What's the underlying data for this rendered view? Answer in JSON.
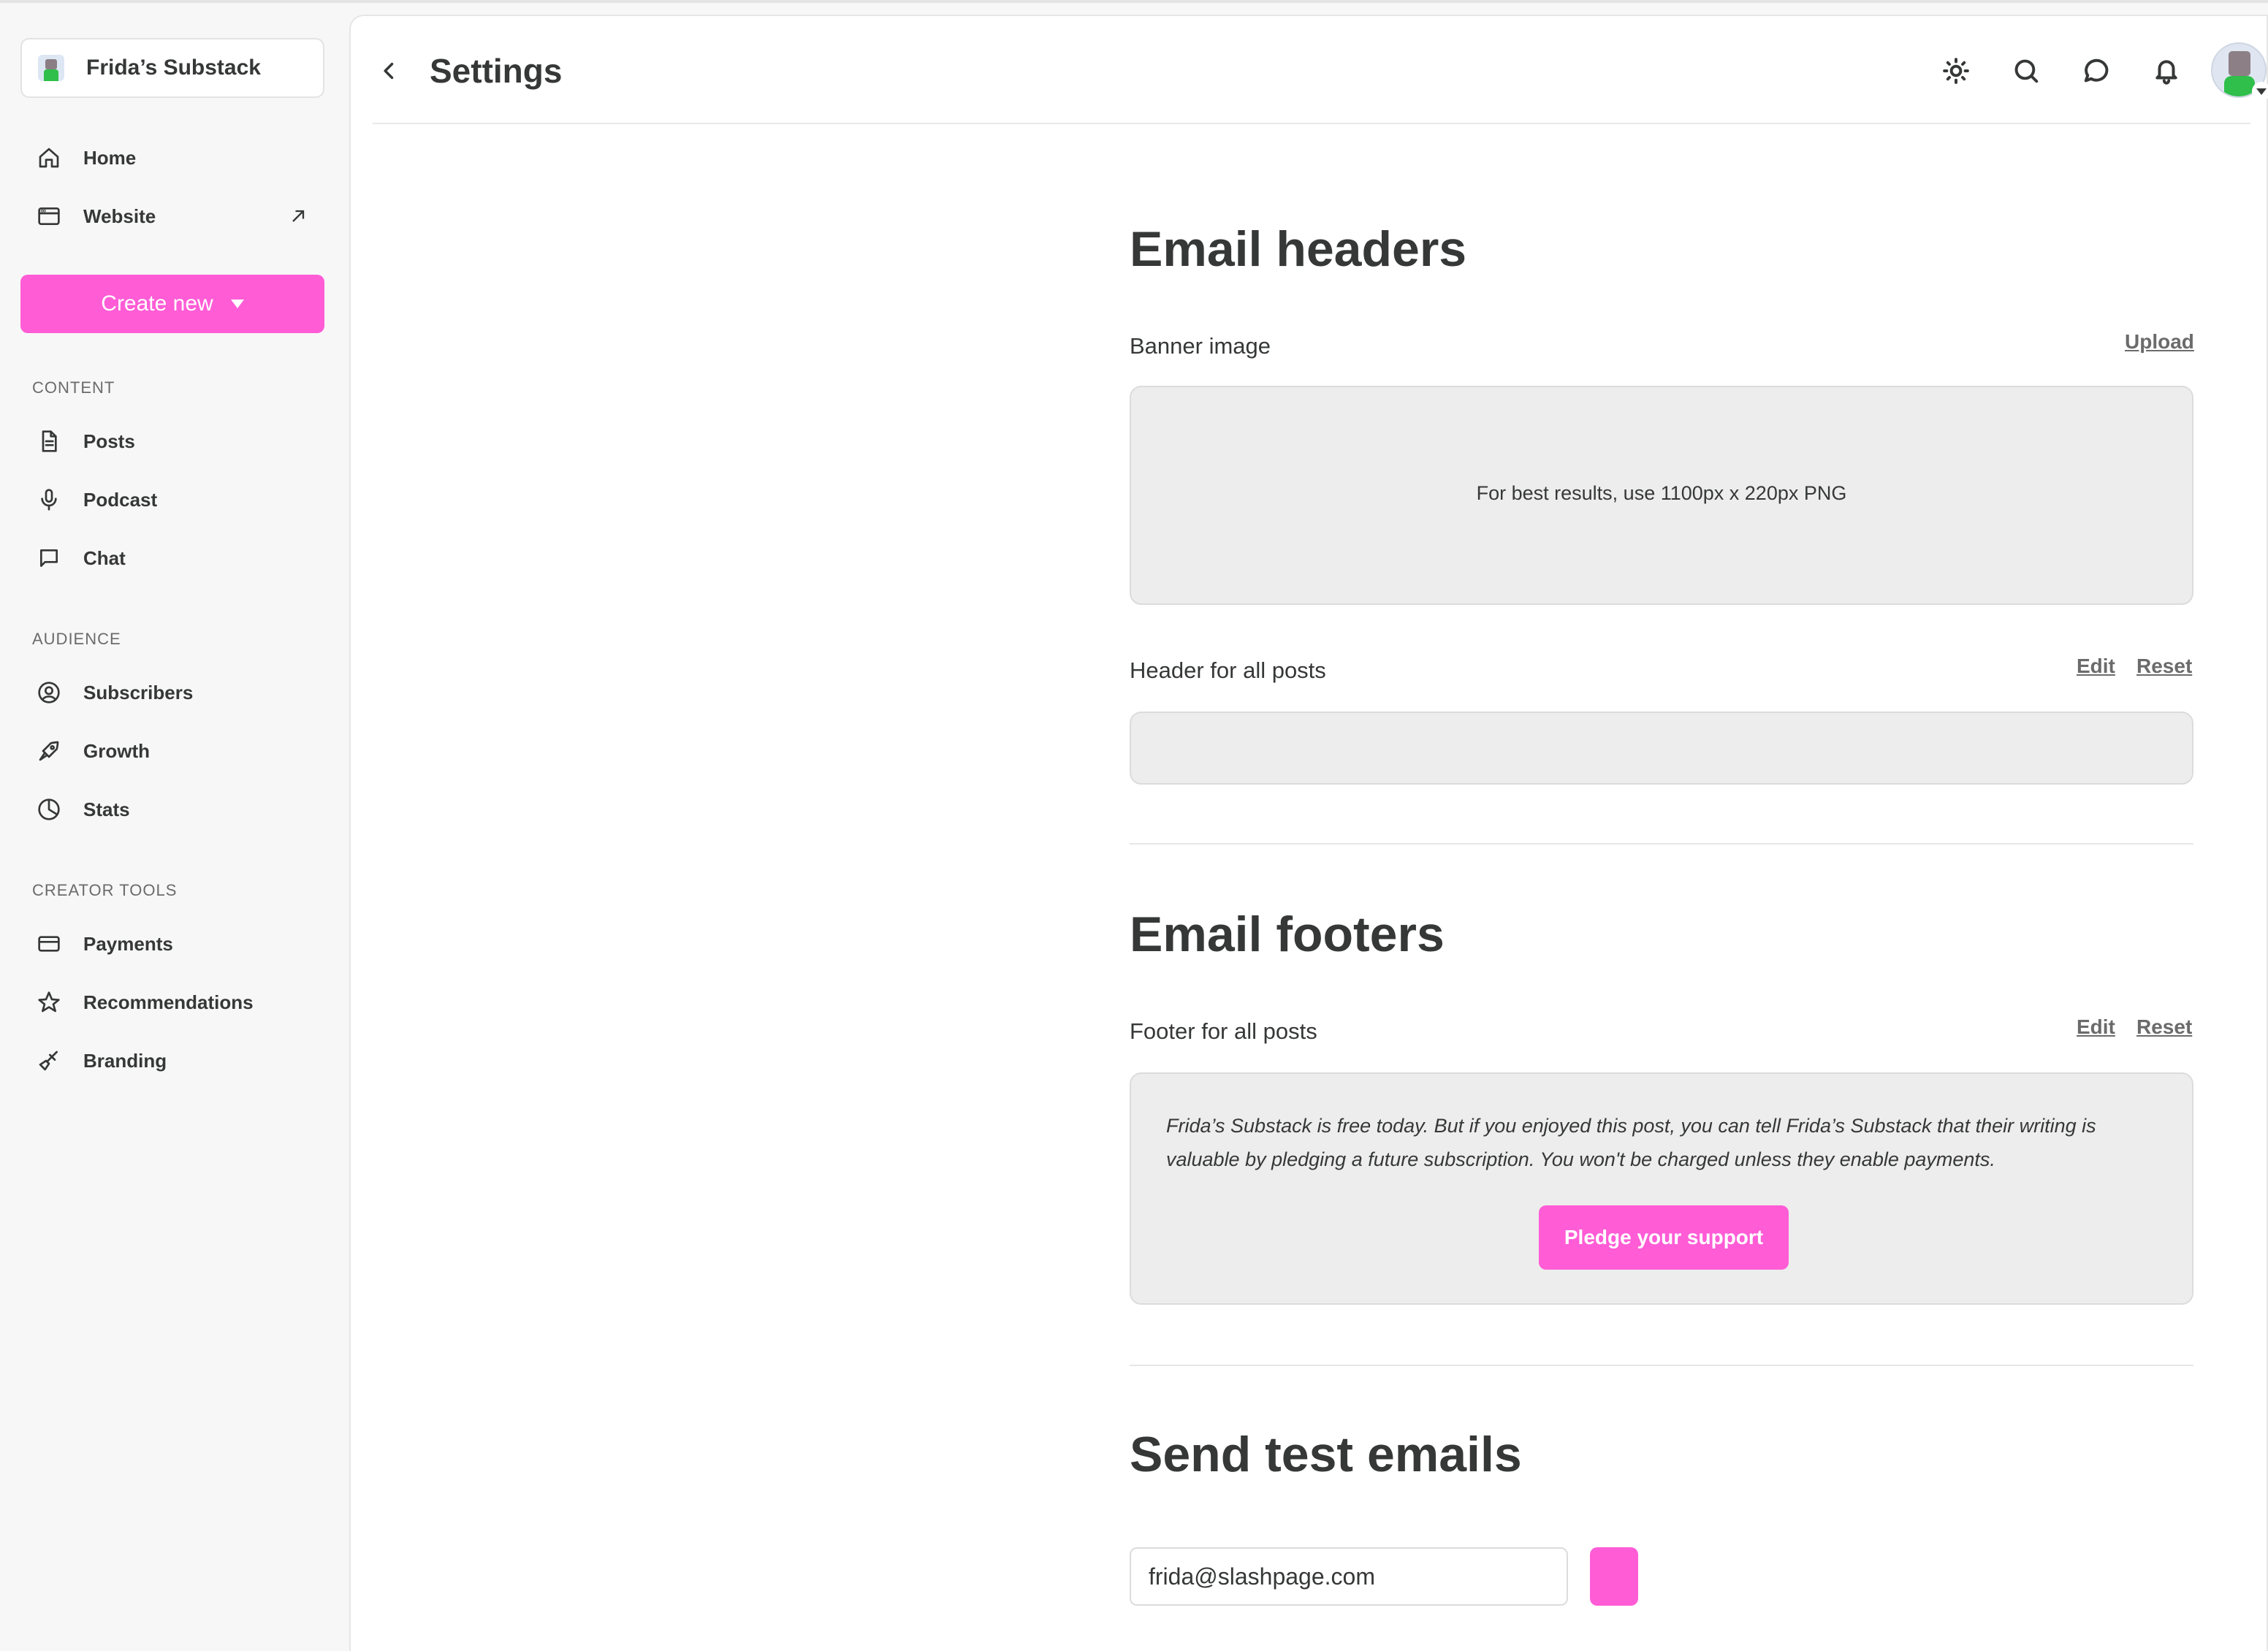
{
  "colors": {
    "accent": "#ff5cd6",
    "text": "#363737",
    "muted": "#6b6b6b",
    "box_bg": "#ededed"
  },
  "sidebar": {
    "publication_name": "Frida’s Substack",
    "nav_top": [
      {
        "label": "Home",
        "icon": "home-icon"
      },
      {
        "label": "Website",
        "icon": "browser-window-icon",
        "external": true
      }
    ],
    "create_label": "Create new",
    "sections": [
      {
        "title": "CONTENT",
        "items": [
          {
            "label": "Posts",
            "icon": "document-icon"
          },
          {
            "label": "Podcast",
            "icon": "microphone-icon"
          },
          {
            "label": "Chat",
            "icon": "chat-bubble-icon"
          }
        ]
      },
      {
        "title": "AUDIENCE",
        "items": [
          {
            "label": "Subscribers",
            "icon": "user-circle-icon"
          },
          {
            "label": "Growth",
            "icon": "rocket-icon"
          },
          {
            "label": "Stats",
            "icon": "pie-chart-icon"
          }
        ]
      },
      {
        "title": "CREATOR TOOLS",
        "items": [
          {
            "label": "Payments",
            "icon": "credit-card-icon"
          },
          {
            "label": "Recommendations",
            "icon": "star-icon"
          },
          {
            "label": "Branding",
            "icon": "paintbrush-icon"
          }
        ]
      }
    ]
  },
  "header": {
    "title": "Settings",
    "icons": [
      "sun-icon",
      "search-icon",
      "chat-bubble-icon",
      "bell-icon"
    ]
  },
  "email_headers": {
    "title": "Email headers",
    "banner_label": "Banner image",
    "upload_link": "Upload",
    "banner_hint": "For best results, use 1100px x 220px PNG",
    "header_label": "Header for all posts",
    "edit_link": "Edit",
    "reset_link": "Reset"
  },
  "email_footers": {
    "title": "Email footers",
    "footer_label": "Footer for all posts",
    "edit_link": "Edit",
    "reset_link": "Reset",
    "footer_text": "Frida’s Substack is free today. But if you enjoyed this post, you can tell Frida’s Substack that their writing is valuable by pledging a future subscription. You won't be charged unless they enable payments.",
    "pledge_button": "Pledge your support"
  },
  "test_emails": {
    "title": "Send test emails",
    "email_value": "frida@slashpage.com"
  }
}
